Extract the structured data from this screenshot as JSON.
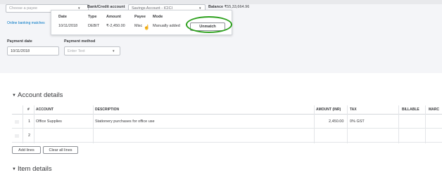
{
  "header": {
    "payee_placeholder": "Choose a payee",
    "bank_label": "Bank/Credit account",
    "bank_value": "Savings Account - ICICI",
    "balance_label": "Balance",
    "balance_value": "₹55,33,664.96"
  },
  "online_link": "Online banking matches",
  "match_popup": {
    "columns": [
      "Date",
      "Type",
      "Amount",
      "Payee",
      "Mode"
    ],
    "row": {
      "date": "10/11/2018",
      "type": "DEBIT",
      "amount": "₹-2,450.00",
      "payee": "Misc",
      "mode": "Manually added"
    },
    "unmatch_label": "Unmatch",
    "highlight_color": "#2ca01c"
  },
  "payment_date": {
    "label": "Payment date",
    "value": "10/11/2018"
  },
  "payment_method": {
    "label": "Payment method",
    "placeholder": "Enter Text"
  },
  "account_details": {
    "toggle": "▼",
    "title": "Account details",
    "columns": [
      "#",
      "ACCOUNT",
      "DESCRIPTION",
      "AMOUNT (INR)",
      "TAX",
      "BILLABLE",
      "MARC"
    ],
    "rows": [
      {
        "num": "1",
        "account": "Office Supplies",
        "description": "Stationery purchases for office use",
        "amount": "2,450.00",
        "tax": "0% GST"
      },
      {
        "num": "2",
        "account": "",
        "description": "",
        "amount": "",
        "tax": ""
      }
    ],
    "add_lines": "Add lines",
    "clear_lines": "Clear all lines"
  },
  "item_details": {
    "toggle": "▼",
    "title": "Item details"
  },
  "icons": {
    "dropdown": "chevron-down-icon",
    "cursor": "hand-cursor-icon",
    "drag": "drag-handle-icon"
  }
}
